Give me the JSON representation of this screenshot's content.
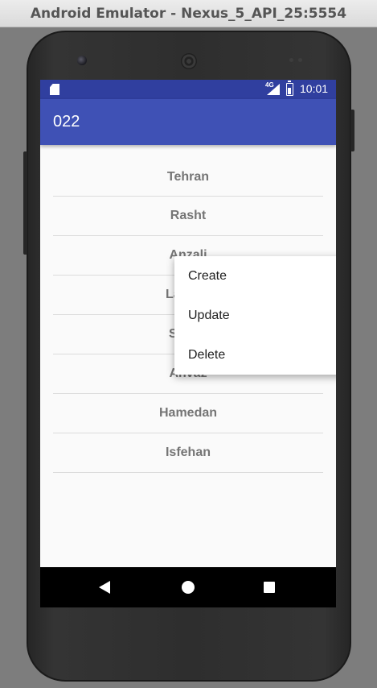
{
  "window": {
    "title": "Android Emulator - Nexus_5_API_25:5554"
  },
  "status_bar": {
    "time": "10:01",
    "network": "4G"
  },
  "app_bar": {
    "title": "022"
  },
  "cities": [
    {
      "name": "Tehran"
    },
    {
      "name": "Rasht"
    },
    {
      "name": "Anzali"
    },
    {
      "name": "Lahijan"
    },
    {
      "name": "Shiraz"
    },
    {
      "name": "Ahvaz"
    },
    {
      "name": "Hamedan"
    },
    {
      "name": "Isfehan"
    }
  ],
  "context_menu": {
    "items": [
      {
        "label": "Create"
      },
      {
        "label": "Update"
      },
      {
        "label": "Delete"
      }
    ]
  },
  "colors": {
    "primary": "#3f51b5",
    "primary_dark": "#303f9f",
    "background": "#fafafa"
  },
  "icons": {
    "status": [
      "sd-card-icon",
      "signal-icon",
      "battery-icon"
    ],
    "navigation": [
      "back-icon",
      "home-icon",
      "recents-icon"
    ]
  }
}
